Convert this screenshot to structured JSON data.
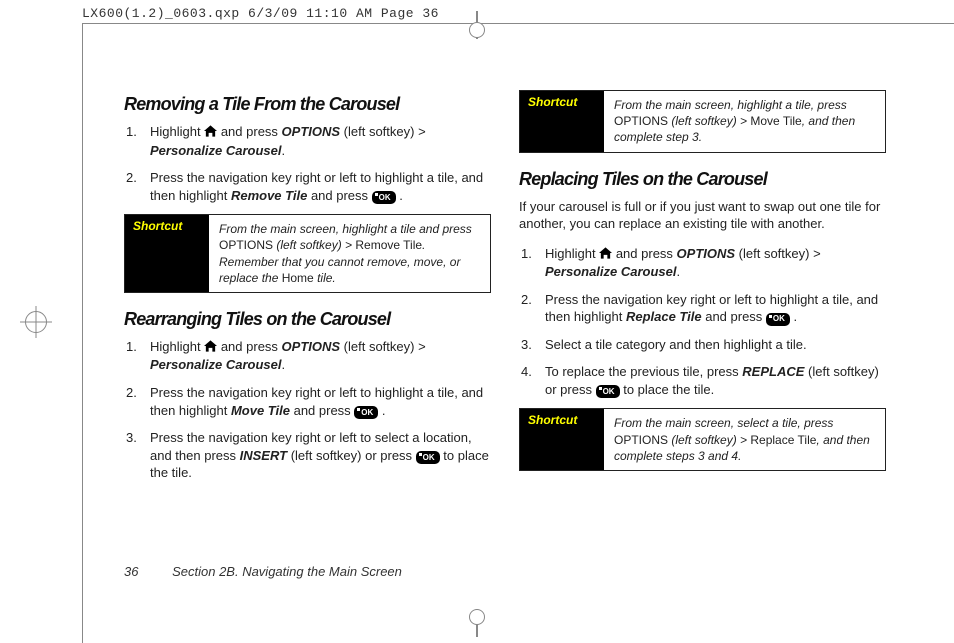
{
  "header": "LX600(1.2)_0603.qxp  6/3/09  11:10 AM  Page 36",
  "footer": {
    "page": "36",
    "section": "Section 2B. Navigating the Main Screen"
  },
  "left": {
    "h1": "Removing a Tile From the Carousel",
    "s1a": "Highlight ",
    "s1b": " and press ",
    "s1_opt": "OPTIONS",
    "s1c": " (left softkey) > ",
    "s1_pc": "Personalize Carousel",
    "s1d": ".",
    "s2a": "Press the navigation key right or left to highlight a tile, and then highlight ",
    "s2_rt": "Remove Tile",
    "s2b": " and press ",
    "s2c": " .",
    "shortcut1": {
      "label": "Shortcut",
      "a": "From the main screen, highlight a tile and press ",
      "b": "OPTIONS",
      "c": " (left softkey) > ",
      "d": "Remove Tile",
      "e": ". Remember that you cannot remove, move, or replace the ",
      "f": "Home",
      "g": " tile."
    },
    "h2": "Rearranging Tiles on the Carousel",
    "r1a": "Highlight ",
    "r1b": " and press ",
    "r1_opt": "OPTIONS",
    "r1c": " (left softkey) > ",
    "r1_pc": "Personalize Carousel",
    "r1d": ".",
    "r2a": "Press the navigation key right or left to highlight a tile, and then highlight ",
    "r2_mt": "Move Tile",
    "r2b": " and press ",
    "r2c": " .",
    "r3a": "Press the navigation key right or left to select a location, and then press ",
    "r3_ins": "INSERT",
    "r3b": " (left softkey) or press ",
    "r3c": " to place the tile."
  },
  "right": {
    "shortcut2": {
      "label": "Shortcut",
      "a": "From the main screen, highlight a tile, press ",
      "b": "OPTIONS",
      "c": " (left softkey) > ",
      "d": "Move Tile",
      "e": ", and then complete step 3."
    },
    "h1": "Replacing Tiles on the Carousel",
    "intro": "If your carousel is full or if you just want to swap out one tile for another, you can replace an existing tile with another.",
    "p1a": "Highlight ",
    "p1b": " and press ",
    "p1_opt": "OPTIONS",
    "p1c": " (left softkey) > ",
    "p1_pc": "Personalize Carousel",
    "p1d": ".",
    "p2a": "Press the navigation key right or left to highlight a tile, and then highlight ",
    "p2_rt": "Replace Tile",
    "p2b": " and press ",
    "p2c": " .",
    "p3": "Select a tile category and then highlight a tile.",
    "p4a": "To replace the previous tile, press ",
    "p4_rep": "REPLACE",
    "p4b": " (left softkey) or press ",
    "p4c": " to place the tile.",
    "shortcut3": {
      "label": "Shortcut",
      "a": "From the main screen, select a tile, press ",
      "b": "OPTIONS",
      "c": " (left softkey) > ",
      "d": "Replace Tile",
      "e": ", and then complete steps 3 and 4."
    }
  },
  "ok": "OK"
}
